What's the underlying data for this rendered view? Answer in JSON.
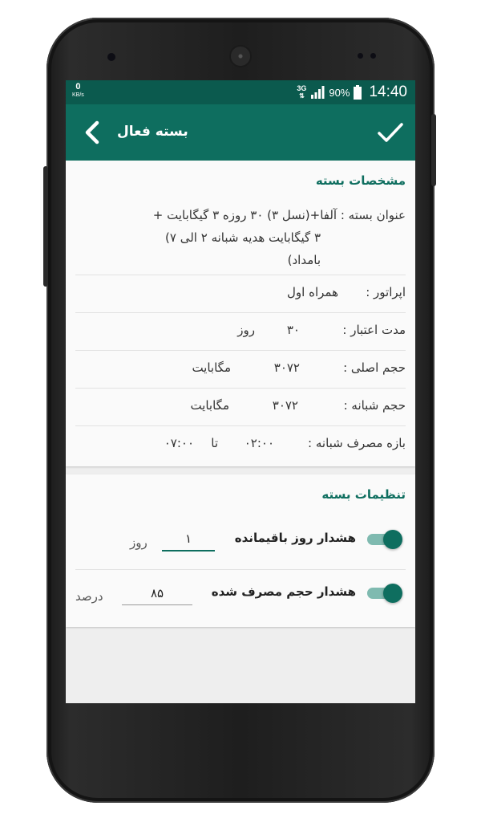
{
  "status_bar": {
    "data_speed_value": "0",
    "data_speed_unit": "KB/s",
    "network_type": "3G",
    "battery_percent": "90%",
    "time": "14:40"
  },
  "app_bar": {
    "title": "بسته فعال",
    "back_icon": "chevron-left-icon",
    "confirm_icon": "check-icon"
  },
  "package_details": {
    "section_title": "مشخصات بسته",
    "title_label": "عنوان بسته :",
    "title_value": "آلفا+(نسل ۳) ۳۰ روزه ۳ گیگابایت + ۳ گیگابایت هدیه شبانه ۲ الی ۷ بامداد)",
    "title_line1": "عنوان بسته : آلفا+(نسل ۳) ۳۰ روزه ۳ گیگابایت +",
    "title_line2": "۳ گیگابایت هدیه شبانه ۲ الی ۷)",
    "title_line3": "بامداد)",
    "operator_label": "اپراتور :",
    "operator_value": "همراه اول",
    "validity_label": "مدت اعتبار :",
    "validity_value": "۳۰",
    "validity_unit": "روز",
    "main_volume_label": "حجم اصلی :",
    "main_volume_value": "۳۰۷۲",
    "main_volume_unit": "مگابایت",
    "night_volume_label": "حجم شبانه :",
    "night_volume_value": "۳۰۷۲",
    "night_volume_unit": "مگابایت",
    "night_period_label": "بازه مصرف شبانه :",
    "night_period_from": "۰۲:۰۰",
    "night_period_to_word": "تا",
    "night_period_to": "۰۷:۰۰"
  },
  "settings": {
    "section_title": "تنظیمات بسته",
    "remaining_days_alert": {
      "label": "هشدار روز باقیمانده",
      "enabled": true,
      "value": "۱",
      "unit": "روز"
    },
    "used_volume_alert": {
      "label": "هشدار حجم مصرف شده",
      "enabled": true,
      "value": "۸۵",
      "unit": "درصد"
    }
  },
  "colors": {
    "status_bar": "#0b5a4e",
    "app_bar": "#0e6e5f",
    "accent": "#0e6e5f",
    "switch_track": "#7fbab0",
    "background": "#eeeeee"
  }
}
